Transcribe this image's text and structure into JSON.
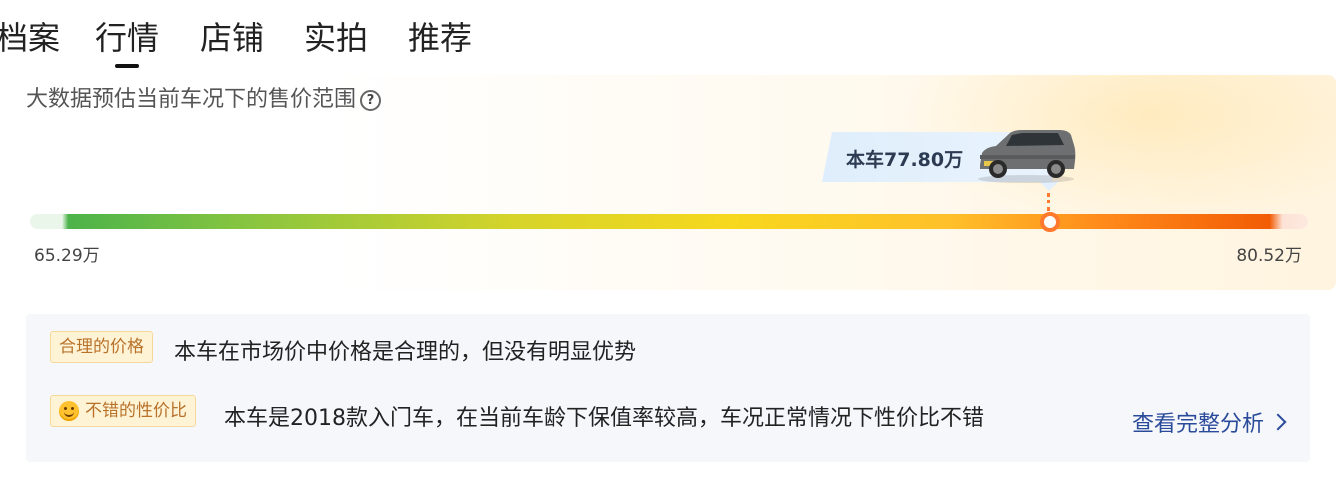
{
  "tabs": [
    {
      "label": "档案",
      "active": false
    },
    {
      "label": "行情",
      "active": true
    },
    {
      "label": "店铺",
      "active": false
    },
    {
      "label": "实拍",
      "active": false
    },
    {
      "label": "推荐",
      "active": false
    }
  ],
  "price_panel": {
    "title": "大数据预估当前车况下的售价范围",
    "help_icon": "question-circle-icon",
    "current_price": "本车77.80万",
    "low_label": "65.29万",
    "high_label": "80.52万",
    "current_position_fraction": 0.835,
    "colors": {
      "marker": "#ff7a2e",
      "bar_start": "#4cb34a",
      "bar_end": "#f25c05"
    }
  },
  "analysis": {
    "items": [
      {
        "tag": "合理的价格",
        "text": "本车在市场价中价格是合理的，但没有明显优势",
        "icon": ""
      },
      {
        "tag": "不错的性价比",
        "text": "本车是2018款入门车，在当前车龄下保值率较高，车况正常情况下性价比不错",
        "icon": "smile-icon"
      }
    ],
    "more_link": "查看完整分析"
  }
}
